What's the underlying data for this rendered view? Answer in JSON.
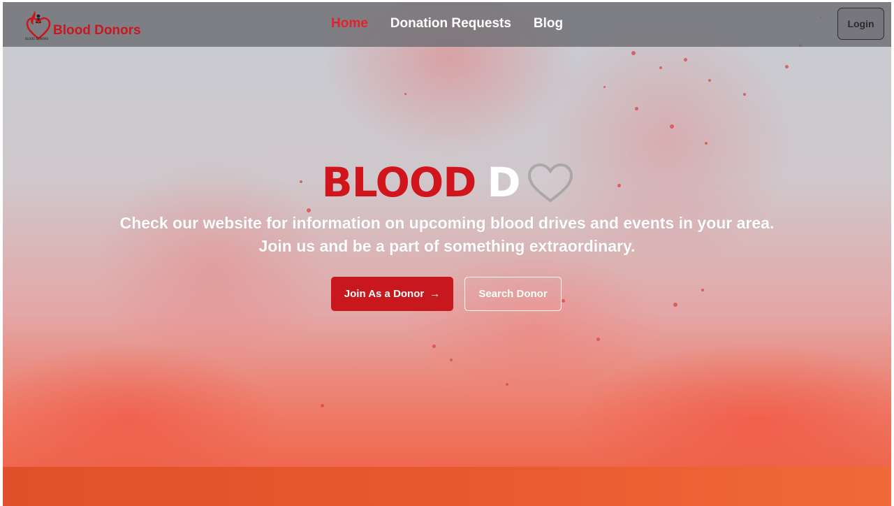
{
  "nav": {
    "brand_name": "Blood Donors",
    "brand_small": "BLOOD DONORS",
    "links": [
      {
        "label": "Home",
        "active": true
      },
      {
        "label": "Donation Requests",
        "active": false
      },
      {
        "label": "Blog",
        "active": false
      }
    ],
    "login_label": "Login"
  },
  "hero": {
    "title_part1": "BLOOD",
    "title_part2": "D",
    "subtitle": "Check our website for information on upcoming blood drives and events in your area. Join us and be a part of something extraordinary.",
    "join_label": "Join As a Donor",
    "join_arrow": "→",
    "search_label": "Search Donor"
  },
  "colors": {
    "brand_red": "#c9171e",
    "active_link": "#e3232b",
    "navbar_bg": "rgba(110,110,115,0.82)",
    "band": "#e9582e"
  },
  "icons": {
    "logo": "blood-drop-heart-logo",
    "heart": "heart-outline-icon",
    "arrow": "arrow-right-icon"
  }
}
